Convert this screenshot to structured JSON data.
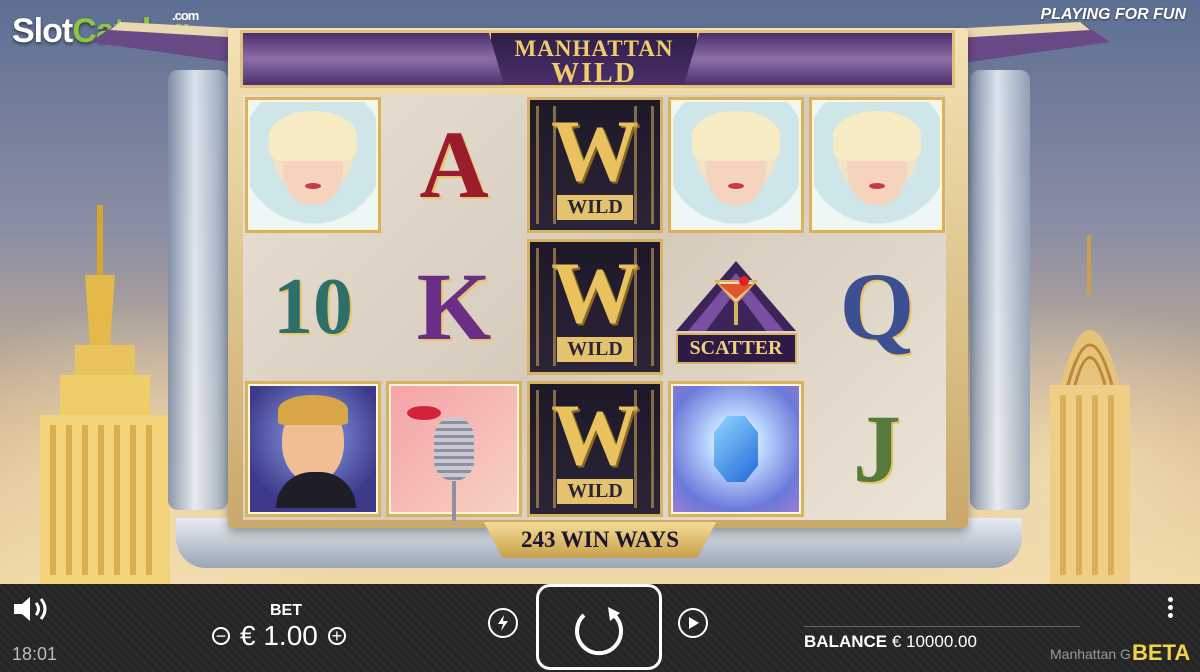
{
  "branding": {
    "logo_slot": "Slot",
    "logo_catalog": "Catalog",
    "logo_com": ".com",
    "playing_mode": "PLAYING FOR FUN"
  },
  "game": {
    "title_line1": "MANHATTAN",
    "title_line2": "WILD",
    "win_ways": "243 WIN WAYS",
    "wild_label": "WILD",
    "scatter_label": "SCATTER",
    "reels": [
      [
        "lady",
        "10",
        "man"
      ],
      [
        "A",
        "K",
        "microphone"
      ],
      [
        "wild",
        "wild",
        "wild"
      ],
      [
        "lady",
        "scatter",
        "gem"
      ],
      [
        "lady",
        "Q",
        "J"
      ]
    ],
    "symbols": {
      "ten": "10",
      "a": "A",
      "k": "K",
      "q": "Q",
      "j": "J"
    }
  },
  "controls": {
    "time": "18:01",
    "bet_label": "BET",
    "bet_value": "€ 1.00",
    "minus": "⊖",
    "plus": "⊕",
    "balance_label": "BALANCE",
    "balance_value": "€ 10000.00",
    "game_name": "Manhattan G",
    "beta": "BETA"
  },
  "colors": {
    "accent_gold": "#e9c15e",
    "purple": "#4a2f6b",
    "beta_yellow": "#f2d44a",
    "logo_green": "#8ec641"
  },
  "icons": [
    "speaker-icon",
    "minus-icon",
    "plus-icon",
    "turbo-icon",
    "spin-icon",
    "autoplay-icon",
    "menu-icon"
  ]
}
